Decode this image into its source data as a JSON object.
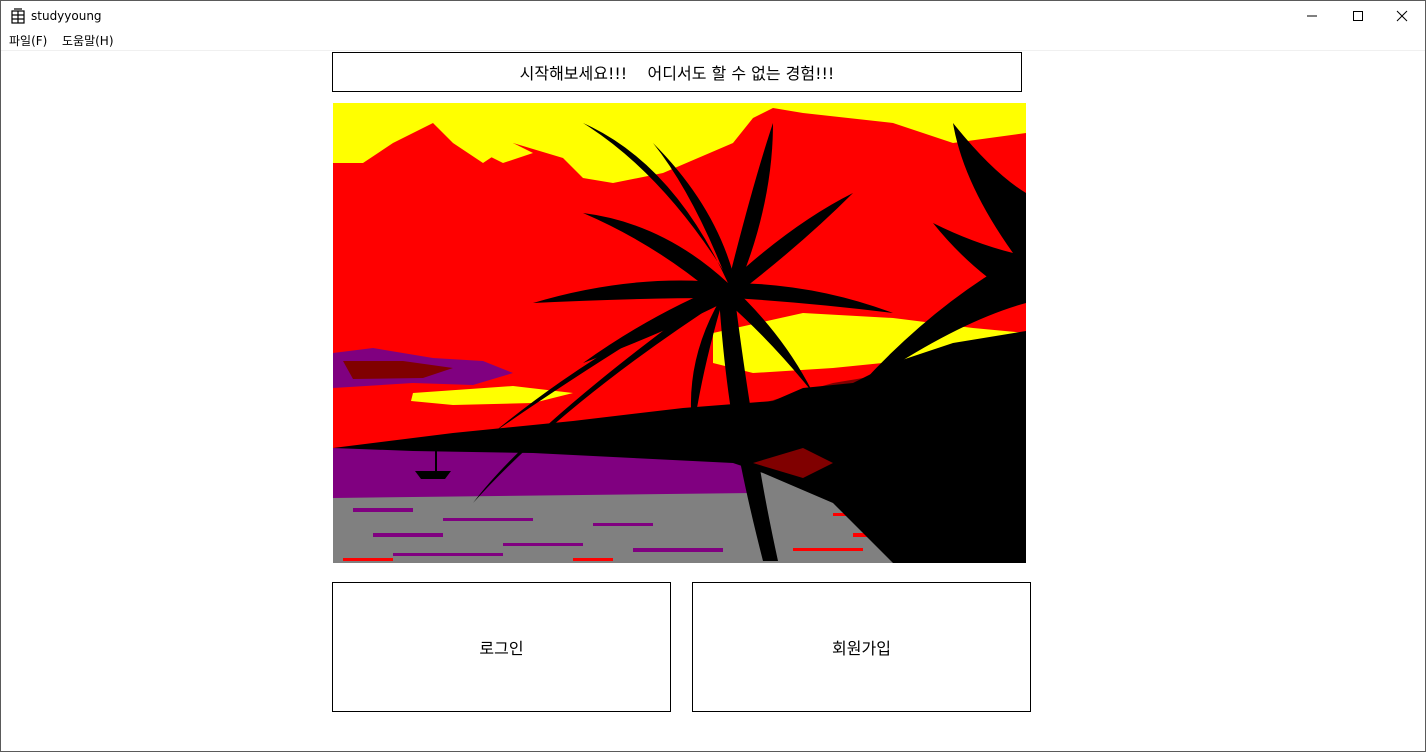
{
  "window": {
    "title": "studyyoung",
    "app_icon": "building-icon",
    "controls": [
      "minimize-icon",
      "maximize-icon",
      "close-icon"
    ]
  },
  "menu": {
    "items": [
      {
        "label": "파일(F)"
      },
      {
        "label": "도움말(H)"
      }
    ]
  },
  "banner": {
    "text": "시작해보세요!!!    어디서도 할 수 없는 경험!!!"
  },
  "picture": {
    "subject": "palm-tree-sunset-image",
    "colors": {
      "sky_yellow": "#ffff00",
      "sky_red": "#ff0000",
      "silhouette": "#000000",
      "water_purple": "#800080",
      "water_grey": "#808080",
      "dark_red": "#800000"
    }
  },
  "buttons": {
    "login_label": "로그인",
    "signup_label": "회원가입"
  }
}
